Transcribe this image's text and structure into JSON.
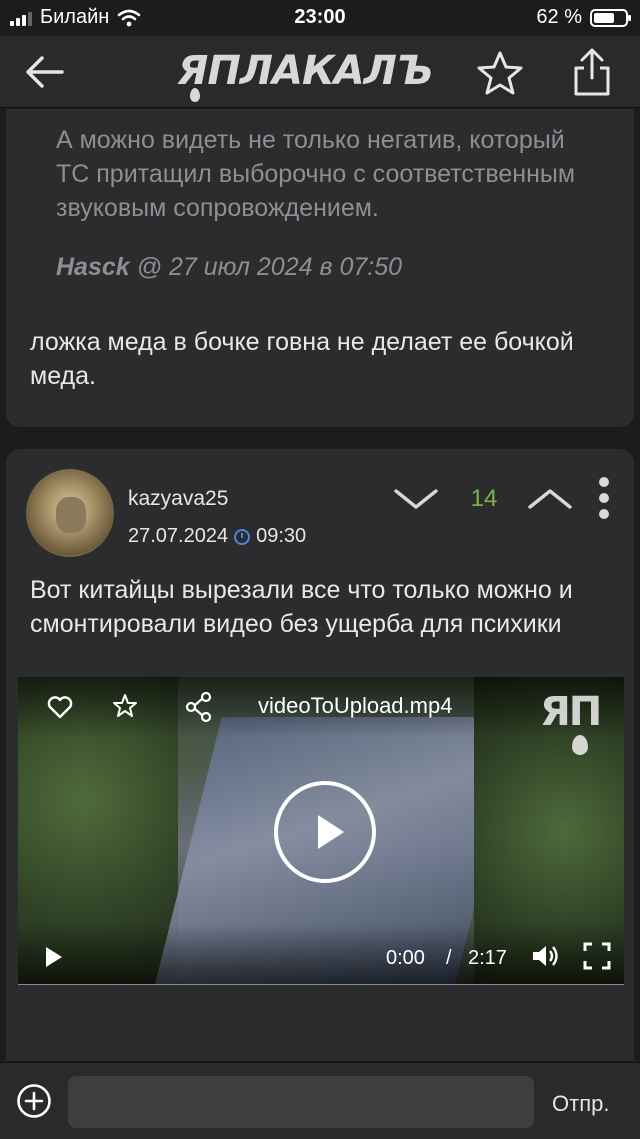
{
  "status": {
    "carrier": "Билайн",
    "time": "23:00",
    "battery": "62 %"
  },
  "nav": {
    "logo": "ЯПЛАКАЛЪ"
  },
  "prev_comment": {
    "quote": "А можно видеть не только негатив, который ТС притащил выборочно с соответственным звуковым сопровождением.",
    "quote_author": "Hasck",
    "quote_date": " @ 27 июл 2024 в 07:50",
    "reply": "ложка меда в бочке говна не делает ее бочкой меда."
  },
  "post": {
    "username": "kazyava25",
    "date": "27.07.2024",
    "time": "09:30",
    "score": "14",
    "text": "Вот китайцы вырезали все что только можно и смонтировали видео без ущерба для психики",
    "video": {
      "title": "videoToUpload.mp4",
      "watermark": "ЯП",
      "current": "0:00",
      "separator": "/",
      "duration": "2:17"
    }
  },
  "composer": {
    "placeholder": "",
    "send_label": "Отпр."
  }
}
